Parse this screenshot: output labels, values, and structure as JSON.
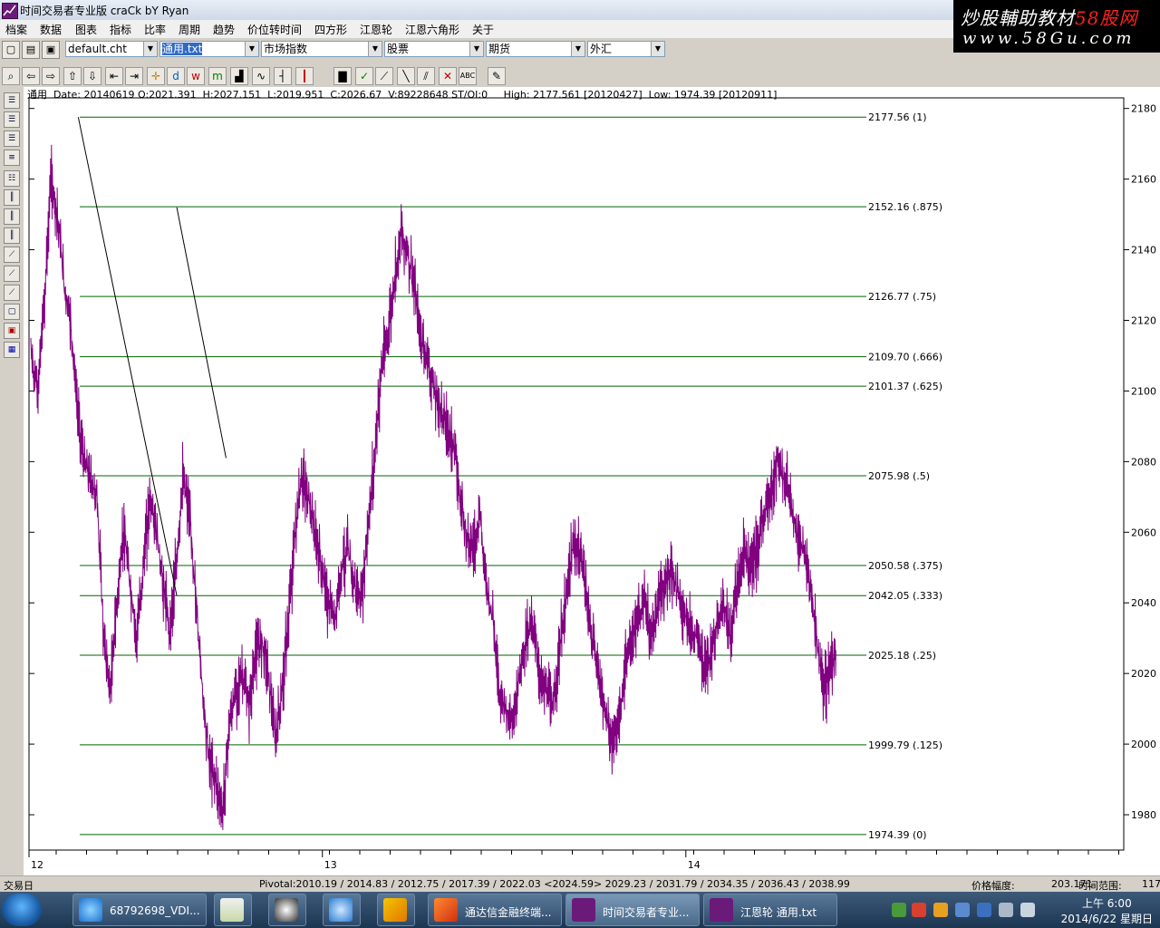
{
  "window": {
    "title": "时间交易者专业版 craCk bY Ryan"
  },
  "watermark": {
    "line1_prefix": "炒股輔助教材",
    "line1_brand": "58",
    "line1_suffix": "股网",
    "line2": "www.58Gu.com"
  },
  "menu": [
    "档案",
    "数据",
    "图表",
    "指标",
    "比率",
    "周期",
    "趋势",
    "价位转时间",
    "四方形",
    "江恩轮",
    "江恩六角形",
    "关于"
  ],
  "combos": {
    "chart_file": "default.cht",
    "symbol_file": "通用.txt",
    "market": "市场指数",
    "stocks": "股票",
    "futures": "期货",
    "forex": "外汇"
  },
  "toolbar_icons": [
    "zoom-icon",
    "arrow-left-icon",
    "arrow-right-icon",
    "arrow-up-icon",
    "arrow-down-icon",
    "compress-icon",
    "expand-icon",
    "crosshair-icon",
    "d-icon",
    "w-icon",
    "m-icon",
    "bar-chart-icon",
    "line-icon",
    "tick-icon",
    "candle-icon",
    "check-icon",
    "trend-icon",
    "line-draw-icon",
    "parallel-icon",
    "eraser-icon",
    "abc-icon",
    "brush-icon"
  ],
  "toolbar_text": {
    "d": "d",
    "w": "w",
    "m": "m"
  },
  "info": {
    "symbol": "通用",
    "date": "Date: 20140619",
    "ohlc": "O:2021.391  H:2027.151  L:2019.951  C:2026.67  V:89228648 ST/OI:0",
    "high": "High: 2177.561 [20120427]",
    "low": "Low: 1974.39 [20120911]"
  },
  "chart_data": {
    "type": "line",
    "title": "",
    "y_axis_ticks": [
      1980,
      2000,
      2020,
      2040,
      2060,
      2080,
      2100,
      2120,
      2140,
      2160,
      2180
    ],
    "ylim": [
      1970,
      2183
    ],
    "x_axis_labels": [
      "12",
      "13",
      "14"
    ],
    "series": [
      {
        "values": [
          2110,
          2100,
          2125,
          2160,
          2150,
          2130,
          2120,
          2095,
          2080,
          2075,
          2070,
          2030,
          2015,
          2040,
          2060,
          2045,
          2030,
          2050,
          2070,
          2060,
          2045,
          2032,
          2050,
          2075,
          2065,
          2040,
          2015,
          1995,
          1990,
          1980,
          2005,
          2015,
          2020,
          2010,
          2025,
          2030,
          2020,
          2000,
          2015,
          2035,
          2060,
          2075,
          2070,
          2060,
          2050,
          2040,
          2035,
          2050,
          2055,
          2045,
          2040,
          2060,
          2080,
          2105,
          2115,
          2130,
          2145,
          2140,
          2130,
          2115,
          2110,
          2100,
          2095,
          2090,
          2085,
          2070,
          2060,
          2055,
          2065,
          2045,
          2035,
          2015,
          2010,
          2005,
          2020,
          2030,
          2035,
          2020,
          2015,
          2010,
          2025,
          2040,
          2055,
          2055,
          2045,
          2030,
          2020,
          2010,
          2000,
          2005,
          2020,
          2030,
          2035,
          2040,
          2030,
          2040,
          2045,
          2050,
          2042,
          2038,
          2032,
          2030,
          2020,
          2025,
          2035,
          2040,
          2030,
          2045,
          2055,
          2050,
          2055,
          2065,
          2070,
          2080,
          2075,
          2070,
          2060,
          2055,
          2045,
          2030,
          2015,
          2020,
          2026.67
        ]
      }
    ],
    "fib_levels": [
      {
        "value": 2177.56,
        "label": "2177.56  (1)"
      },
      {
        "value": 2152.16,
        "label": "2152.16  (.875)"
      },
      {
        "value": 2126.77,
        "label": "2126.77  (.75)"
      },
      {
        "value": 2109.7,
        "label": "2109.70  (.666)"
      },
      {
        "value": 2101.37,
        "label": "2101.37  (.625)"
      },
      {
        "value": 2075.98,
        "label": "2075.98  (.5)"
      },
      {
        "value": 2050.58,
        "label": "2050.58  (.375)"
      },
      {
        "value": 2042.05,
        "label": "2042.05  (.333)"
      },
      {
        "value": 2025.18,
        "label": "2025.18  (.25)"
      },
      {
        "value": 1999.79,
        "label": "1999.79  (.125)"
      },
      {
        "value": 1974.39,
        "label": "1974.39  (0)"
      }
    ],
    "trendlines": [
      {
        "from": [
          0.045,
          2177.56
        ],
        "to": [
          0.135,
          2042
        ]
      },
      {
        "from": [
          0.135,
          2152
        ],
        "to": [
          0.18,
          2081
        ]
      }
    ],
    "colors": {
      "price": "#800080",
      "fib": "#006400",
      "trend": "#000000"
    }
  },
  "status": {
    "left": "交易日",
    "pivot": "Pivotal:2010.19 / 2014.83 / 2012.75 / 2017.39 / 2022.03 <2024.59> 2029.23 / 2031.79 / 2034.35 / 2036.43 / 2038.99",
    "price_range_label": "价格幅度:",
    "price_range_value": "203.171",
    "time_range_label": "时间范围:",
    "time_range_value": "117"
  },
  "taskbar": {
    "items": [
      {
        "label": "68792698_VDI..."
      },
      {
        "label": "通达信金融终端..."
      },
      {
        "label": "时间交易者专业..."
      },
      {
        "label": "江恩轮    通用.txt"
      }
    ],
    "clock_time": "上午 6:00",
    "clock_date": "2014/6/22 星期日"
  }
}
